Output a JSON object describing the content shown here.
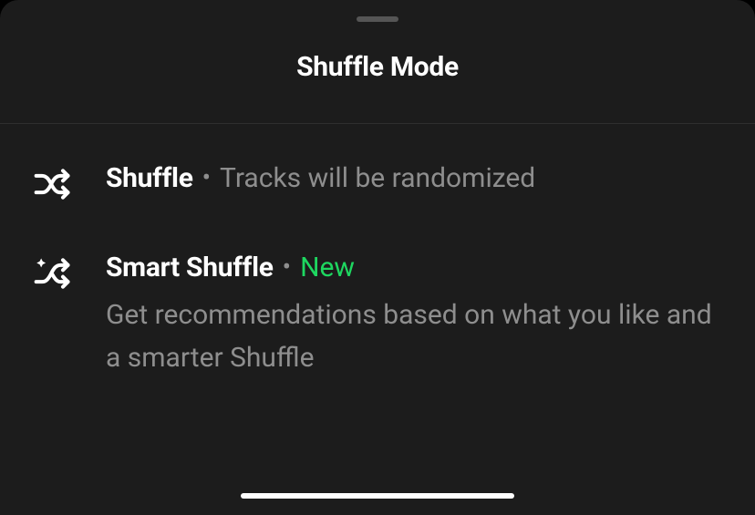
{
  "title": "Shuffle Mode",
  "options": [
    {
      "label": "Shuffle",
      "inline_desc": "Tracks will be randomized",
      "badge": null,
      "desc": null
    },
    {
      "label": "Smart Shuffle",
      "inline_desc": null,
      "badge": "New",
      "desc": "Get recommendations based on what you like and a smarter Shuffle"
    }
  ]
}
